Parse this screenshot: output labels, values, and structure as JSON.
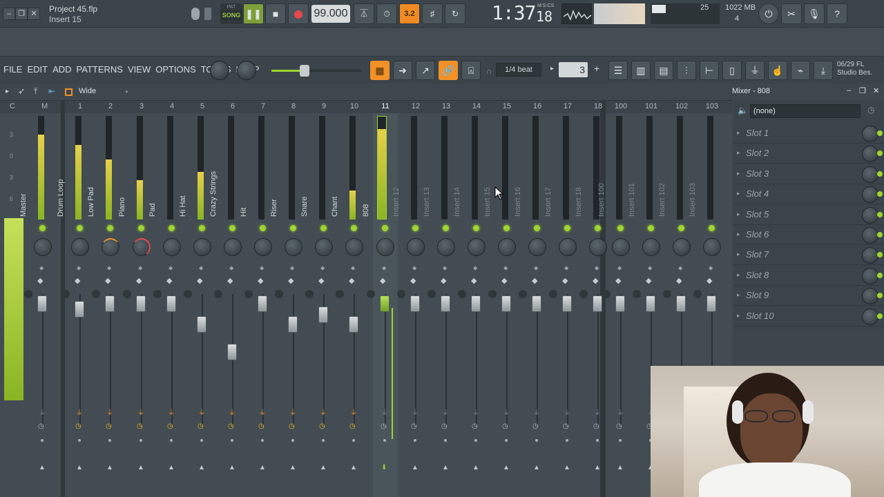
{
  "window": {
    "project_file": "Project 45.flp",
    "focused": "Insert 15",
    "minimize": "–",
    "restore": "❐",
    "close": "✕"
  },
  "transport": {
    "pat_label": "PAT",
    "song_label": "SONG",
    "play": "❚❚",
    "stop": "■",
    "tempo": "99.000",
    "time": "1:37",
    "time_ticks": "18",
    "time_unit": "M:S:CS"
  },
  "toolbar_icons": [
    "metronome-icon",
    "wait-icon",
    "countdown-icon",
    "step-edit-icon",
    "loop-record-icon"
  ],
  "countdown_label": "3.2",
  "monitor": {
    "cpu_label": "25",
    "memory": "1022 MB",
    "polyphony": "4"
  },
  "top_right_icons": [
    "reset-icon",
    "scissors-icon",
    "mic-icon",
    "help-icon"
  ],
  "menu": [
    "FILE",
    "EDIT",
    "ADD",
    "PATTERNS",
    "VIEW",
    "OPTIONS",
    "TOOLS",
    "HELP"
  ],
  "snap": {
    "value": "1/4 beat",
    "pattern_number": "3"
  },
  "news": {
    "date": "06/29",
    "line1": "FL",
    "line2": "Studio Bes."
  },
  "mixer": {
    "view_label": "Wide",
    "title": "Mixer - 808",
    "header_c": "C",
    "header_m": "M",
    "db_scale": [
      "3",
      "0",
      "3",
      "6"
    ],
    "tracks": [
      {
        "no": "",
        "name": "Master",
        "level": 0.82,
        "knob": "none"
      },
      {
        "no": "1",
        "name": "Drum Loop",
        "level": 0.72,
        "knob": "none"
      },
      {
        "no": "2",
        "name": "Low Pad",
        "level": 0.58,
        "knob": "left"
      },
      {
        "no": "3",
        "name": "Piano",
        "level": 0.38,
        "knob": "right"
      },
      {
        "no": "4",
        "name": "Pad",
        "level": 0.0,
        "knob": "none"
      },
      {
        "no": "5",
        "name": "Hi Hat",
        "level": 0.46,
        "knob": "none"
      },
      {
        "no": "6",
        "name": "Crazy Strings",
        "level": 0.0,
        "knob": "none"
      },
      {
        "no": "7",
        "name": "Hit",
        "level": 0.0,
        "knob": "none"
      },
      {
        "no": "8",
        "name": "Riser",
        "level": 0.0,
        "knob": "none"
      },
      {
        "no": "9",
        "name": "Snare",
        "level": 0.0,
        "knob": "none"
      },
      {
        "no": "10",
        "name": "Chant",
        "level": 0.28,
        "knob": "none"
      },
      {
        "no": "11",
        "name": "808",
        "level": 0.88,
        "knob": "none",
        "selected": true
      },
      {
        "no": "12",
        "name": "Insert 12",
        "level": 0,
        "knob": "none"
      },
      {
        "no": "13",
        "name": "Insert 13",
        "level": 0,
        "knob": "none"
      },
      {
        "no": "14",
        "name": "Insert 14",
        "level": 0,
        "knob": "none"
      },
      {
        "no": "15",
        "name": "Insert 15",
        "level": 0,
        "knob": "none"
      },
      {
        "no": "16",
        "name": "Insert 16",
        "level": 0,
        "knob": "none"
      },
      {
        "no": "17",
        "name": "Insert 17",
        "level": 0,
        "knob": "none"
      },
      {
        "no": "18",
        "name": "Insert 18",
        "level": 0,
        "knob": "none"
      },
      {
        "no": "100",
        "name": "Insert 100",
        "level": 0,
        "knob": "none"
      },
      {
        "no": "101",
        "name": "Insert 101",
        "level": 0,
        "knob": "none"
      },
      {
        "no": "102",
        "name": "Insert 102",
        "level": 0,
        "knob": "none"
      },
      {
        "no": "103",
        "name": "Insert 103",
        "level": 0,
        "knob": "none"
      }
    ],
    "input_select": "(none)",
    "slots": [
      "Slot 1",
      "Slot 2",
      "Slot 3",
      "Slot 4",
      "Slot 5",
      "Slot 6",
      "Slot 7",
      "Slot 8",
      "Slot 9",
      "Slot 10"
    ]
  },
  "colors": {
    "accent_green": "#9fd431",
    "accent_orange": "#f29127",
    "background": "#424c52"
  }
}
